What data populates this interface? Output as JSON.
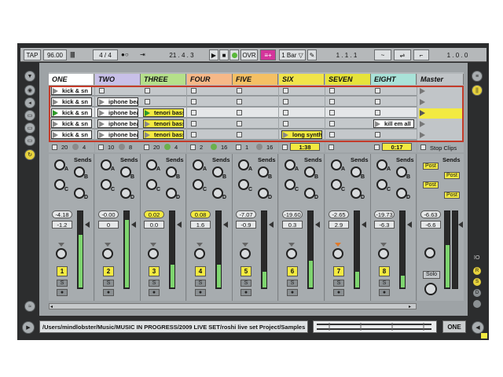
{
  "transport": {
    "tap": "TAP",
    "tempo": "96.00",
    "signature": "4 / 4",
    "position": "21 .  4 .  3",
    "ovr": "OVR",
    "quantize": "1 Bar",
    "loop_start": "1 .  1 .  1",
    "loop_end": "1 .  0 .  0"
  },
  "tracks": [
    {
      "name": "ONE",
      "color": "#ffffff",
      "clips": [
        "kick & sn",
        "kick & sn",
        "kick & sn",
        "kick & sn",
        "kick & sn"
      ],
      "ctl1": "20",
      "ctl2": "4",
      "vol": "-4.18",
      "pan": "-1.2",
      "num": "1",
      "vol_highlight": false,
      "meter": 0.68
    },
    {
      "name": "TWO",
      "color": "#c8c0e8",
      "clips": [
        "",
        "iphone beat",
        "iphone beat",
        "iphone beat",
        "iphone beat"
      ],
      "ctl1": "10",
      "ctl2": "8",
      "vol": "-0.00",
      "pan": "0",
      "num": "2",
      "vol_highlight": false,
      "meter": 0.88
    },
    {
      "name": "THREE",
      "color": "#b5e08a",
      "clips": [
        "",
        "",
        "tenori bass",
        "tenori bass",
        "tenori bass"
      ],
      "ctl1": "20",
      "ctl2": "4",
      "vol": "0.02",
      "pan": "0.0",
      "num": "3",
      "vol_highlight": true,
      "meter": 0.3
    },
    {
      "name": "FOUR",
      "color": "#f6b888",
      "clips": [
        "",
        "",
        "",
        "",
        ""
      ],
      "ctl1": "2",
      "ctl2": "16",
      "vol": "0.08",
      "pan": "1.6",
      "num": "4",
      "vol_highlight": true,
      "meter": 0.3
    },
    {
      "name": "FIVE",
      "color": "#f4c064",
      "clips": [
        "",
        "",
        "",
        "",
        ""
      ],
      "ctl1": "1",
      "ctl2": "16",
      "vol": "-7.07",
      "pan": "-0.9",
      "num": "5",
      "vol_highlight": false,
      "meter": 0.2
    },
    {
      "name": "SIX",
      "color": "#f1e44a",
      "clips": [
        "",
        "",
        "",
        "",
        "long synth ("
      ],
      "ctl1": "1:38",
      "ctl2": "",
      "vol": "-19.60",
      "pan": "0.3",
      "num": "6",
      "vol_highlight": false,
      "meter": 0.35
    },
    {
      "name": "SEVEN",
      "color": "#e6e33a",
      "clips": [
        "",
        "",
        "",
        "",
        ""
      ],
      "ctl1": "",
      "ctl2": "",
      "vol": "-2.65",
      "pan": "2.9",
      "num": "7",
      "vol_highlight": false,
      "meter": 0.2
    },
    {
      "name": "EIGHT",
      "color": "#a9e2d8",
      "clips": [
        "",
        "",
        "",
        "kill em all",
        ""
      ],
      "ctl1": "0:17",
      "ctl2": "",
      "vol": "-19.73",
      "pan": "-6.3",
      "num": "8",
      "vol_highlight": false,
      "meter": 0.15
    }
  ],
  "master": {
    "name": "Master",
    "stop_clips": "Stop Clips",
    "sends_label": "Sends",
    "post_labels": [
      "Post",
      "Post",
      "Post",
      "Post"
    ],
    "vol": "-6.63",
    "pan": "-6.6",
    "solo": "Solo",
    "meter": 0.55
  },
  "labels": {
    "sends": "Sends",
    "knob_a": "A",
    "knob_b": "B",
    "knob_c": "C",
    "knob_d": "D",
    "s_btn": "S",
    "io_labels": [
      "IO",
      "R",
      "S",
      "D"
    ]
  },
  "bottom": {
    "path": "/Users/mindlobster/Music/MUSIC IN PROGRESS/2009 LIVE SET/roshi live set Project/Samples",
    "selected_track": "ONE"
  },
  "colors": {
    "highlight_yellow": "#f3ea41",
    "selection_red": "#c33b2a",
    "meter_green": "#7ed56f",
    "accent_pink": "#d4349b"
  }
}
